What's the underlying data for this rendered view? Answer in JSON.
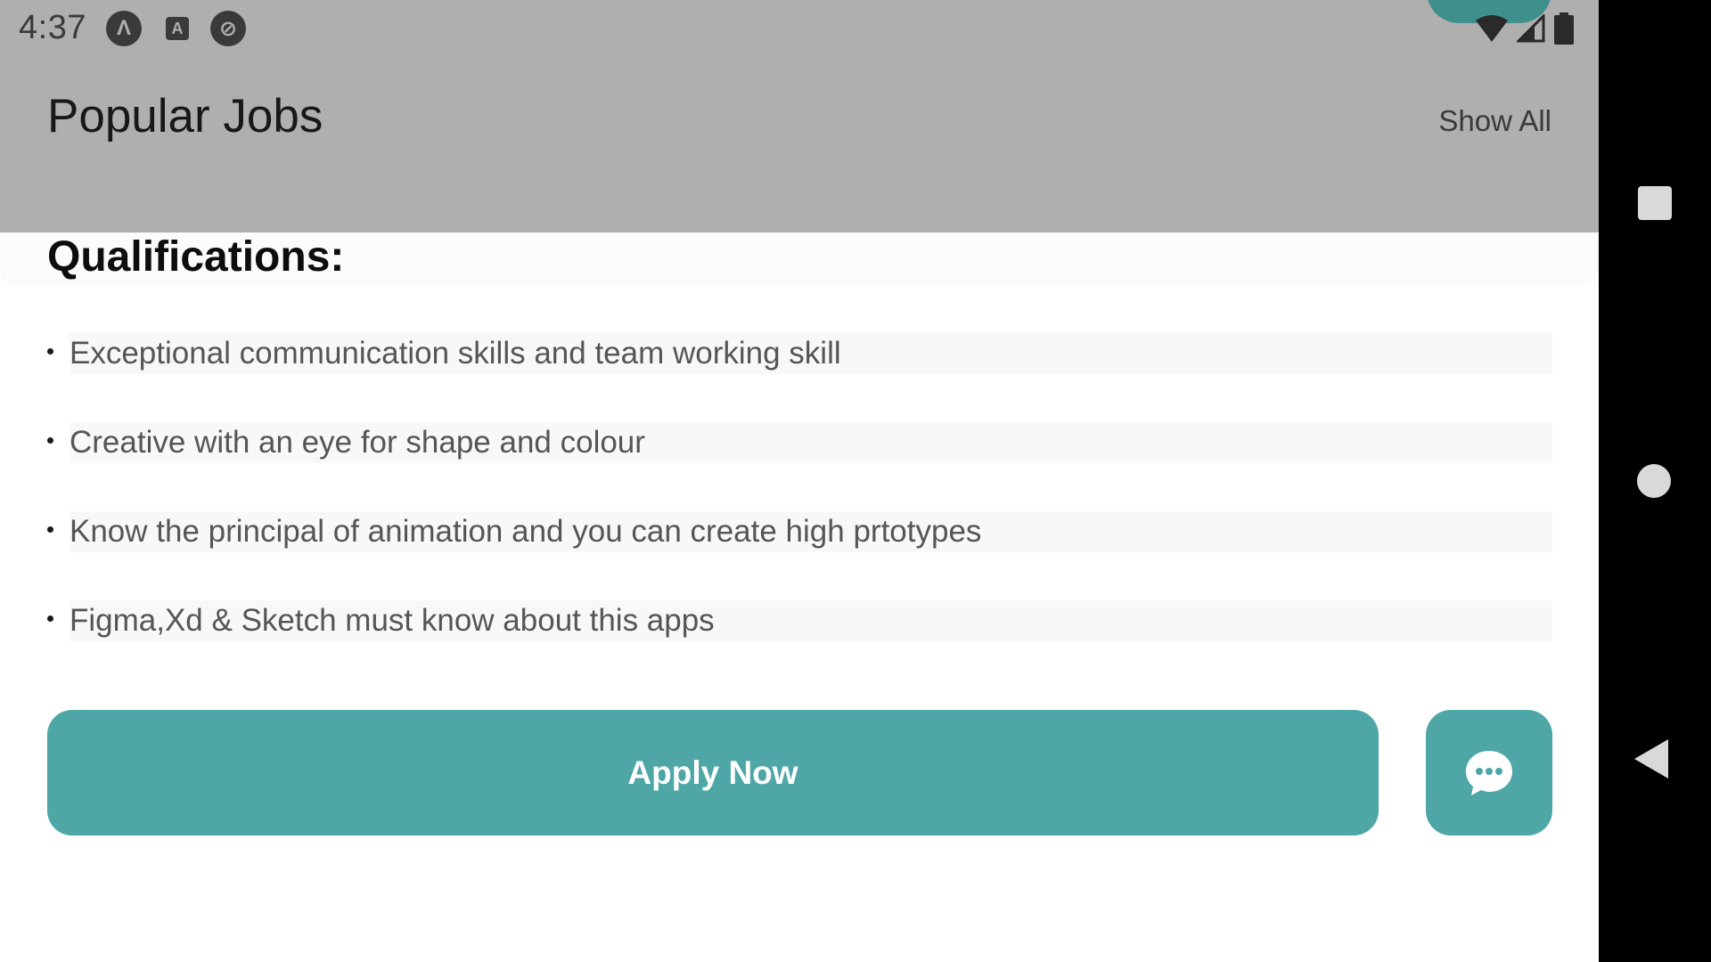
{
  "status_bar": {
    "time": "4:37",
    "left_icons": [
      "app-a-icon",
      "font-a-icon",
      "sync-off-icon"
    ],
    "right_icons": [
      "wifi-icon",
      "signal-icon",
      "battery-icon"
    ],
    "left_icon_glyphs": [
      "Λ",
      "A",
      "⊘"
    ]
  },
  "header": {
    "title": "Popular Jobs",
    "show_all": "Show All"
  },
  "qualifications": {
    "title": "Qualifications:",
    "items": [
      "Exceptional communication skills and team working skill",
      "Creative with an eye for shape and colour",
      "Know the principal of animation and you can create high prtotypes",
      "Figma,Xd & Sketch must know about this apps"
    ]
  },
  "actions": {
    "apply_label": "Apply Now",
    "chat_icon": "chat-bubble-icon"
  },
  "nav": {
    "icons": [
      "recents-icon",
      "home-icon",
      "back-icon"
    ]
  },
  "colors": {
    "accent": "#4ea6a7",
    "scrim": "#afafaf",
    "nav_bar": "#000000"
  }
}
